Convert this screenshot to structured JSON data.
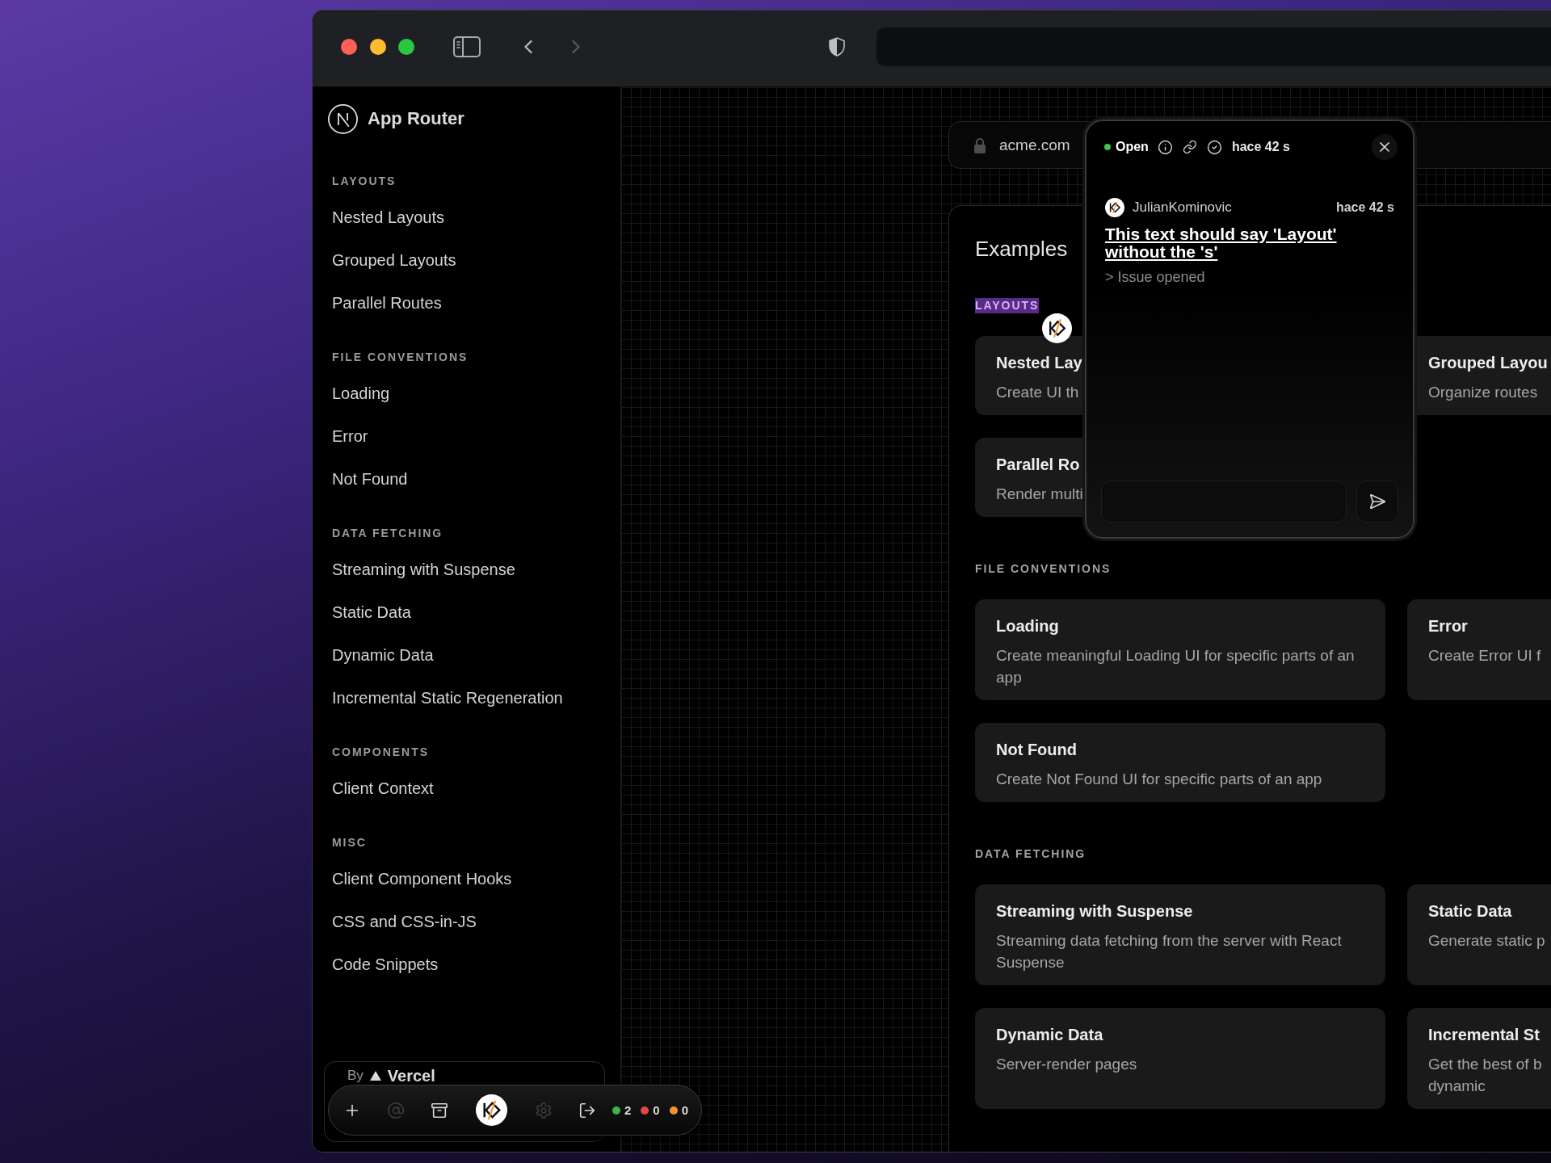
{
  "browser": {
    "nav_buttons": [
      {
        "kind": "back",
        "disabled": false
      },
      {
        "kind": "forward",
        "disabled": true
      }
    ]
  },
  "sidebar": {
    "title": "App Router",
    "sections": [
      {
        "heading": "LAYOUTS",
        "items": [
          "Nested Layouts",
          "Grouped Layouts",
          "Parallel Routes"
        ]
      },
      {
        "heading": "FILE CONVENTIONS",
        "items": [
          "Loading",
          "Error",
          "Not Found"
        ]
      },
      {
        "heading": "DATA FETCHING",
        "items": [
          "Streaming with Suspense",
          "Static Data",
          "Dynamic Data",
          "Incremental Static Regeneration"
        ]
      },
      {
        "heading": "COMPONENTS",
        "items": [
          "Client Context"
        ]
      },
      {
        "heading": "MISC",
        "items": [
          "Client Component Hooks",
          "CSS and CSS-in-JS",
          "Code Snippets"
        ]
      }
    ],
    "footer": {
      "prefix": "By",
      "brand": "Vercel"
    }
  },
  "preview": {
    "url": "acme.com",
    "title": "Examples",
    "sections": [
      {
        "heading": "LAYOUTS",
        "highlighted": true,
        "cards": [
          {
            "title": "Nested Lay",
            "description": "Create UI th"
          },
          {
            "title": "Grouped Layou",
            "description": "Organize routes"
          },
          {
            "title": "Parallel Ro",
            "description": "Render multi"
          }
        ]
      },
      {
        "heading": "FILE CONVENTIONS",
        "highlighted": false,
        "cards": [
          {
            "title": "Loading",
            "description": "Create meaningful Loading UI for specific parts of an app"
          },
          {
            "title": "Error",
            "description": "Create Error UI f"
          },
          {
            "title": "Not Found",
            "description": "Create Not Found UI for specific parts of an app"
          }
        ]
      },
      {
        "heading": "DATA FETCHING",
        "highlighted": false,
        "cards": [
          {
            "title": "Streaming with Suspense",
            "description": "Streaming data fetching from the server with React Suspense"
          },
          {
            "title": "Static Data",
            "description": "Generate static p"
          },
          {
            "title": "Dynamic Data",
            "description": "Server-render pages"
          },
          {
            "title": "Incremental St",
            "description": "Get the best of b\ndynamic"
          }
        ]
      }
    ]
  },
  "comment_popup": {
    "status": "Open",
    "time": "hace 42 s",
    "comment": {
      "author": "JulianKominovic",
      "time": "hace 42 s",
      "title": "This text should say 'Layout' without the 's'",
      "body": "> Issue opened"
    }
  },
  "toolbar": {
    "buttons": [
      {
        "kind": "add",
        "disabled": false
      },
      {
        "kind": "mention",
        "disabled": true
      },
      {
        "kind": "archive",
        "disabled": false
      },
      {
        "kind": "avatar",
        "disabled": false
      },
      {
        "kind": "settings",
        "disabled": true
      },
      {
        "kind": "logout",
        "disabled": false
      }
    ],
    "counters": [
      {
        "count": "2",
        "color": "#3fb24b"
      },
      {
        "count": "0",
        "color": "#e24848"
      },
      {
        "count": "0",
        "color": "#f0952d"
      }
    ]
  }
}
